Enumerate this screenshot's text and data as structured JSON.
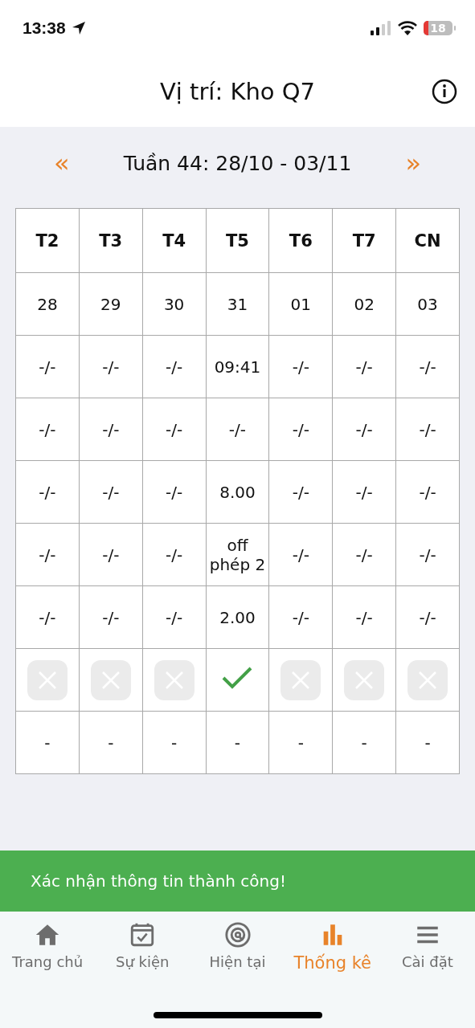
{
  "status_bar": {
    "time": "13:38",
    "battery": "18"
  },
  "header": {
    "title": "Vị trí: Kho Q7"
  },
  "week_nav": {
    "prev": "«",
    "label": "Tuần 44: 28/10 - 03/11",
    "next": "»"
  },
  "table": {
    "columns": [
      "T2",
      "T3",
      "T4",
      "T5",
      "T6",
      "T7",
      "CN"
    ],
    "rows": [
      {
        "kind": "text",
        "cells": [
          "28",
          "29",
          "30",
          "31",
          "01",
          "02",
          "03"
        ]
      },
      {
        "kind": "text",
        "cells": [
          "-/-",
          "-/-",
          "-/-",
          "09:41",
          "-/-",
          "-/-",
          "-/-"
        ]
      },
      {
        "kind": "text",
        "cells": [
          "-/-",
          "-/-",
          "-/-",
          "-/-",
          "-/-",
          "-/-",
          "-/-"
        ]
      },
      {
        "kind": "text",
        "cells": [
          "-/-",
          "-/-",
          "-/-",
          "8.00",
          "-/-",
          "-/-",
          "-/-"
        ]
      },
      {
        "kind": "text",
        "cells": [
          "-/-",
          "-/-",
          "-/-",
          "off phép 2",
          "-/-",
          "-/-",
          "-/-"
        ]
      },
      {
        "kind": "text",
        "cells": [
          "-/-",
          "-/-",
          "-/-",
          "2.00",
          "-/-",
          "-/-",
          "-/-"
        ]
      },
      {
        "kind": "status",
        "cells": [
          {
            "confirmed": false
          },
          {
            "confirmed": false
          },
          {
            "confirmed": false
          },
          {
            "confirmed": true
          },
          {
            "confirmed": false
          },
          {
            "confirmed": false
          },
          {
            "confirmed": false
          }
        ]
      },
      {
        "kind": "text",
        "cells": [
          "-",
          "-",
          "-",
          "-",
          "-",
          "-",
          "-"
        ]
      }
    ]
  },
  "toast": {
    "message": "Xác nhận thông tin thành công!"
  },
  "tab_bar": [
    {
      "label": "Trang chủ",
      "selected": false
    },
    {
      "label": "Sự kiện",
      "selected": false
    },
    {
      "label": "Hiện tại",
      "selected": false
    },
    {
      "label": "Thống kê",
      "selected": true
    },
    {
      "label": "Cài đặt",
      "selected": false
    }
  ]
}
